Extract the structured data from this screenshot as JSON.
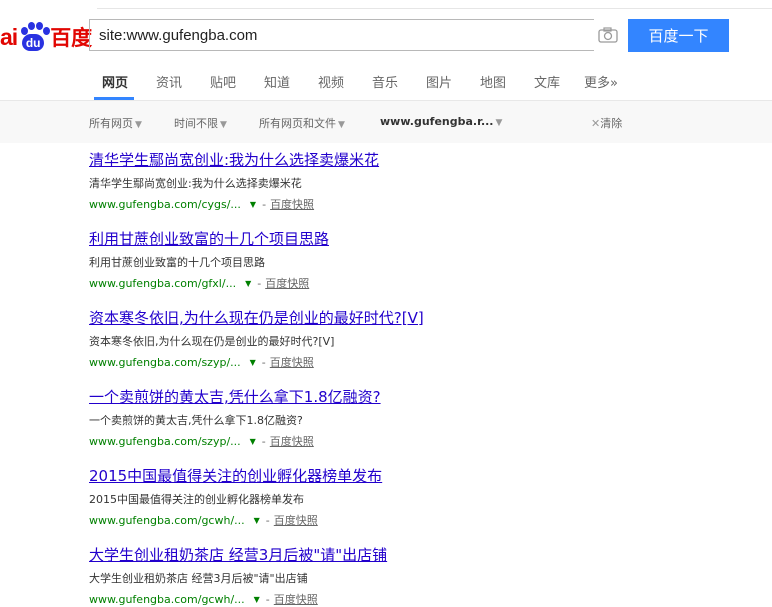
{
  "logo": {
    "text_bai": "ai",
    "text_du": "du",
    "text_name": "百度"
  },
  "search": {
    "value": "site:www.gufengba.com",
    "button_label": "百度一下"
  },
  "tabs": [
    {
      "label": "网页"
    },
    {
      "label": "资讯"
    },
    {
      "label": "贴吧"
    },
    {
      "label": "知道"
    },
    {
      "label": "视频"
    },
    {
      "label": "音乐"
    },
    {
      "label": "图片"
    },
    {
      "label": "地图"
    },
    {
      "label": "文库"
    },
    {
      "label": "更多»"
    }
  ],
  "filters": [
    {
      "label": "所有网页"
    },
    {
      "label": "时间不限"
    },
    {
      "label": "所有网页和文件"
    },
    {
      "label": "www.gufengba.r..."
    }
  ],
  "clear_label": "清除",
  "results": [
    {
      "title": "清华学生鄢尚宽创业:我为什么选择卖爆米花",
      "snippet": "清华学生鄢尚宽创业:我为什么选择卖爆米花",
      "url": "www.gufengba.com/cygs/...",
      "cache": "百度快照"
    },
    {
      "title": "利用甘蔗创业致富的十几个项目思路",
      "snippet": "利用甘蔗创业致富的十几个项目思路",
      "url": "www.gufengba.com/gfxl/...",
      "cache": "百度快照"
    },
    {
      "title": "资本寒冬依旧,为什么现在仍是创业的最好时代?[V]",
      "snippet": "资本寒冬依旧,为什么现在仍是创业的最好时代?[V]",
      "url": "www.gufengba.com/szyp/...",
      "cache": "百度快照"
    },
    {
      "title": "一个卖煎饼的黄太吉,凭什么拿下1.8亿融资?",
      "snippet": "一个卖煎饼的黄太吉,凭什么拿下1.8亿融资?",
      "url": "www.gufengba.com/szyp/...",
      "cache": "百度快照"
    },
    {
      "title": "2015中国最值得关注的创业孵化器榜单发布",
      "snippet": "2015中国最值得关注的创业孵化器榜单发布",
      "url": "www.gufengba.com/gcwh/...",
      "cache": "百度快照"
    },
    {
      "title": "大学生创业租奶茶店 经营3月后被\"请\"出店铺",
      "snippet": "大学生创业租奶茶店 经营3月后被\"请\"出店铺",
      "url": "www.gufengba.com/gcwh/...",
      "cache": "百度快照"
    }
  ]
}
